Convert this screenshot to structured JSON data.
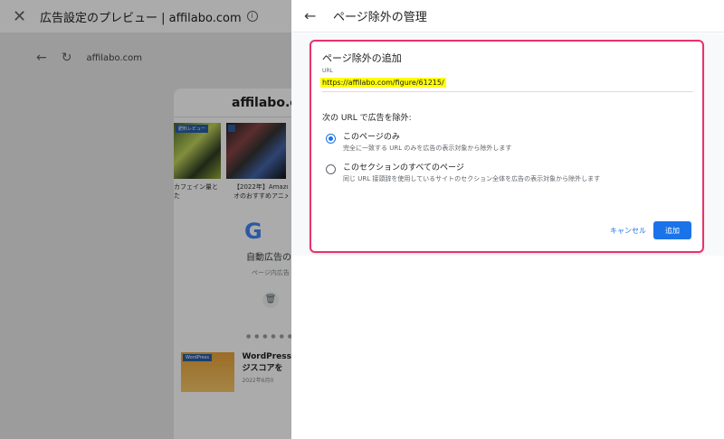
{
  "preview": {
    "title": "広告設定のプレビュー | affilabo.com",
    "address": "affilabo.com",
    "site_logo": "affilabo.co",
    "thumb_tag_1": "肥料レビュー",
    "caption_1": "カフェイン量と",
    "caption_1b": "た",
    "caption_2": "【2022年】Amazonプ",
    "caption_2b": "オのおすすめアニメ【厳",
    "google_logo": "G",
    "google_title": "自動広告の",
    "google_sub": "ページ内広告",
    "post_tag": "WordPress",
    "post_title": "WordPress",
    "post_title2": "ジスコアを",
    "post_date": "2022年6月0"
  },
  "panel": {
    "title": "ページ除外の管理",
    "card_title": "ページ除外の追加",
    "url_label": "URL",
    "url_value": "https://affilabo.com/figure/61215/",
    "section_label": "次の URL で広告を除外:",
    "options": [
      {
        "title": "このページのみ",
        "desc": "完全に一致する URL のみを広告の表示対象から除外します",
        "selected": true
      },
      {
        "title": "このセクションのすべてのページ",
        "desc": "同じ URL 接頭辞を使用しているサイトのセクション全体を広告の表示対象から除外します",
        "selected": false
      }
    ],
    "cancel_label": "キャンセル",
    "add_label": "追加"
  },
  "colors": {
    "accent": "#1a73e8",
    "highlight_border": "#e8336b",
    "url_highlight": "#ffff00"
  }
}
